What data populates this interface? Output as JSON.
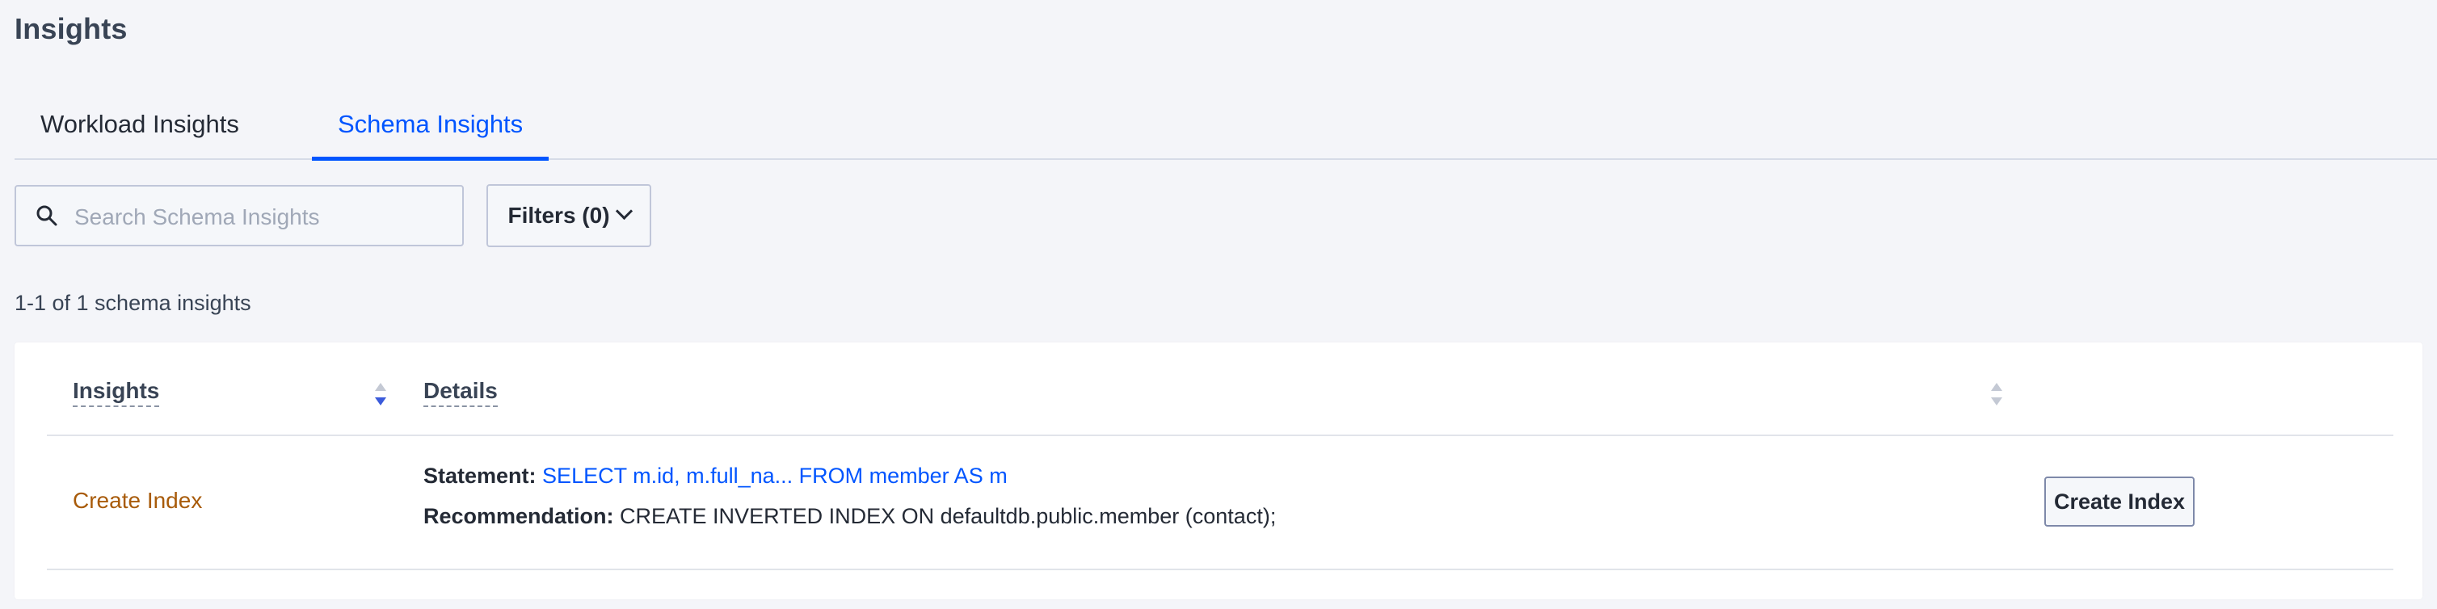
{
  "page": {
    "title": "Insights"
  },
  "tabs": [
    {
      "label": "Workload Insights",
      "active": false
    },
    {
      "label": "Schema Insights",
      "active": true
    }
  ],
  "search": {
    "placeholder": "Search Schema Insights",
    "value": ""
  },
  "filters": {
    "label": "Filters (0)"
  },
  "results": {
    "count_text": "1-1 of 1 schema insights"
  },
  "table": {
    "columns": [
      {
        "label": "Insights"
      },
      {
        "label": "Details"
      }
    ],
    "rows": [
      {
        "insight": "Create Index",
        "statement_label": "Statement:",
        "statement_value": "SELECT m.id, m.full_na... FROM member AS m",
        "recommendation_label": "Recommendation:",
        "recommendation_value": "CREATE INVERTED INDEX ON defaultdb.public.member (contact);",
        "action_label": "Create Index"
      }
    ]
  },
  "icons": {
    "search": "search-icon",
    "chevron": "chevron-down-icon",
    "sort": "sort-icon"
  },
  "colors": {
    "accent": "#0055ff",
    "insight_type": "#a85b0a",
    "text": "#394455",
    "background": "#f4f5f9"
  }
}
